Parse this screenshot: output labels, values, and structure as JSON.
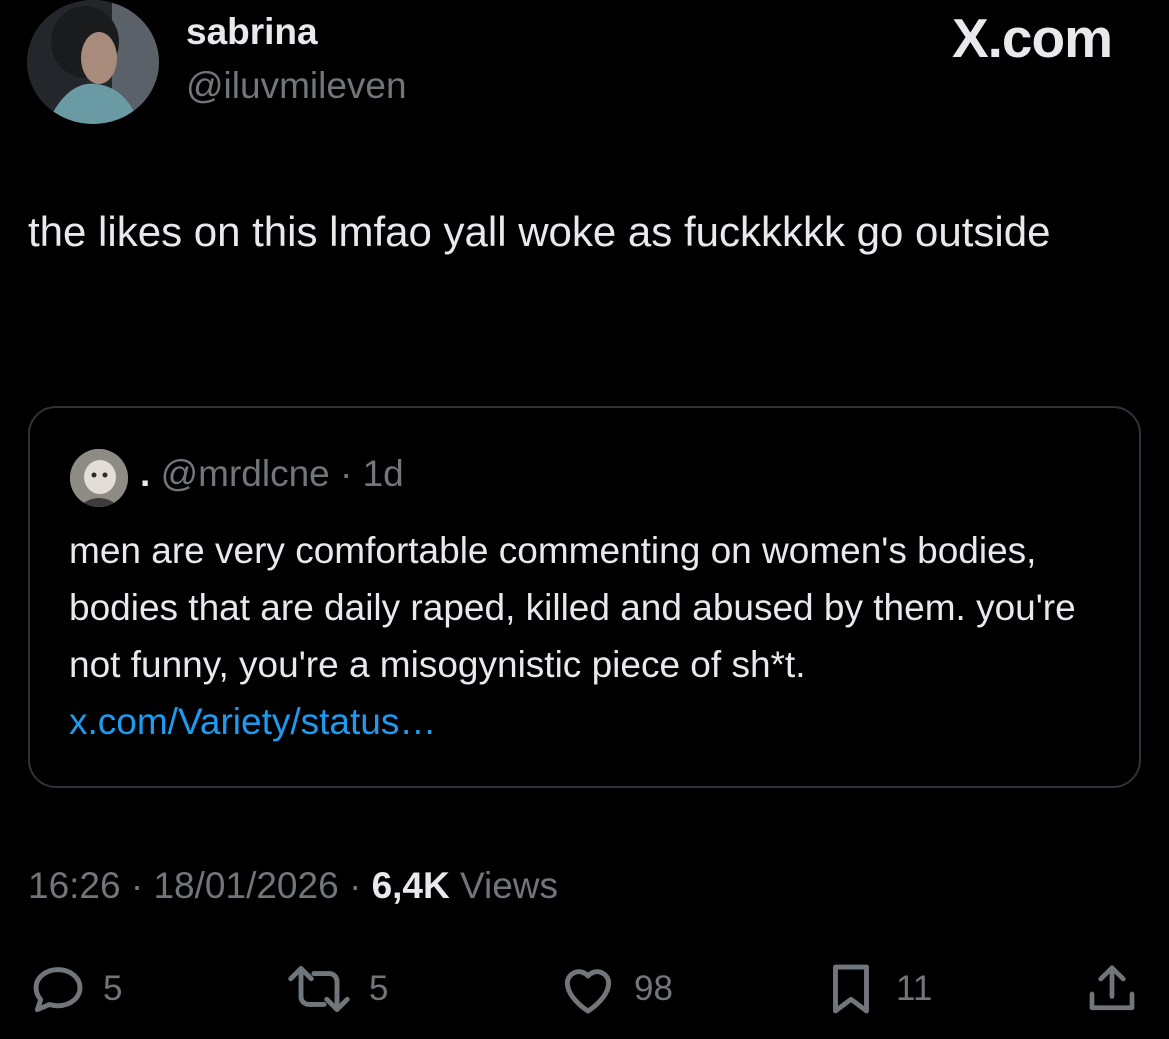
{
  "header": {
    "display_name": "sabrina",
    "handle": "@iluvmileven",
    "brand": "X.com"
  },
  "tweet": {
    "text": "the likes on this lmfao yall woke as fuckkkkk go outside"
  },
  "quote": {
    "name": ".",
    "handle": "@mrdlcne",
    "separator": "·",
    "age": "1d",
    "text": "men are very comfortable commenting on women's bodies, bodies that are daily raped, killed and abused by them. you're not funny, you're a misogynistic piece of sh*t.",
    "link": "x.com/Variety/status…"
  },
  "meta": {
    "time": "16:26",
    "date": "18/01/2026",
    "separator": "·",
    "views_count": "6,4K",
    "views_label": "Views"
  },
  "actions": {
    "replies": "5",
    "reposts": "5",
    "likes": "98",
    "bookmarks": "11"
  },
  "colors": {
    "background": "#000000",
    "text": "#e7e9ea",
    "secondary": "#71767b",
    "link": "#1d9bf0",
    "border": "#2f3336"
  },
  "icons": {
    "reply": "comment-bubble-icon",
    "repost": "repost-arrows-icon",
    "like": "heart-icon",
    "bookmark": "bookmark-icon",
    "share": "share-icon"
  }
}
